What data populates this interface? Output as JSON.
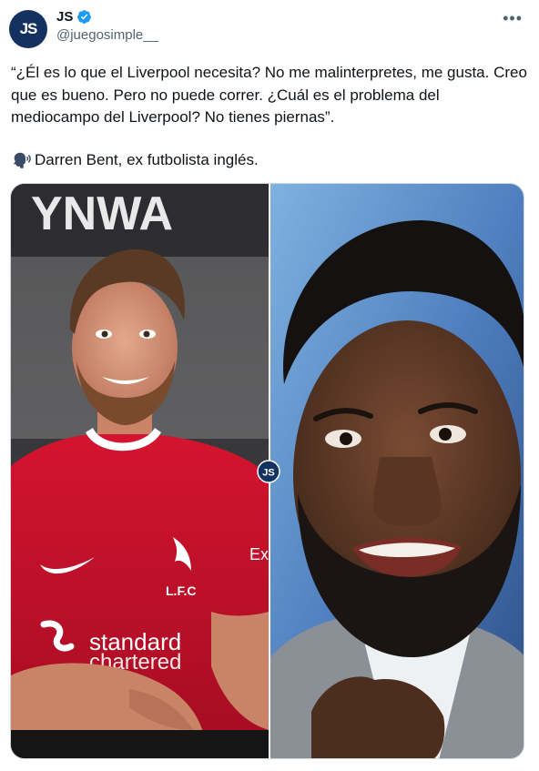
{
  "author": {
    "avatar_text": "JS",
    "display_name": "JS",
    "handle": "@juegosimple__",
    "verified": true
  },
  "menu_icon": "more-options-icon",
  "tweet": {
    "quote": "“¿Él es lo que el Liverpool necesita? No me malinterpretes, me gusta. Creo que es bueno. Pero no puede correr. ¿Cuál es el problema del mediocampo del Liverpool? No tienes piernas”.",
    "attribution_icon": "speaking-head-icon",
    "attribution": "Darren Bent, ex futbolista inglés."
  },
  "media": {
    "left_photo": {
      "background_text": "YNWA",
      "crest_text": "L.F.C",
      "sponsor_line1": "standard",
      "sponsor_line2": "chartered",
      "sleeve_text": "Ex"
    },
    "center_badge": "JS"
  },
  "colors": {
    "accent_blue": "#1d9bf0",
    "brand_navy": "#15315f",
    "jersey_red": "#c8102e",
    "text_primary": "#0f1419",
    "text_secondary": "#536471"
  }
}
